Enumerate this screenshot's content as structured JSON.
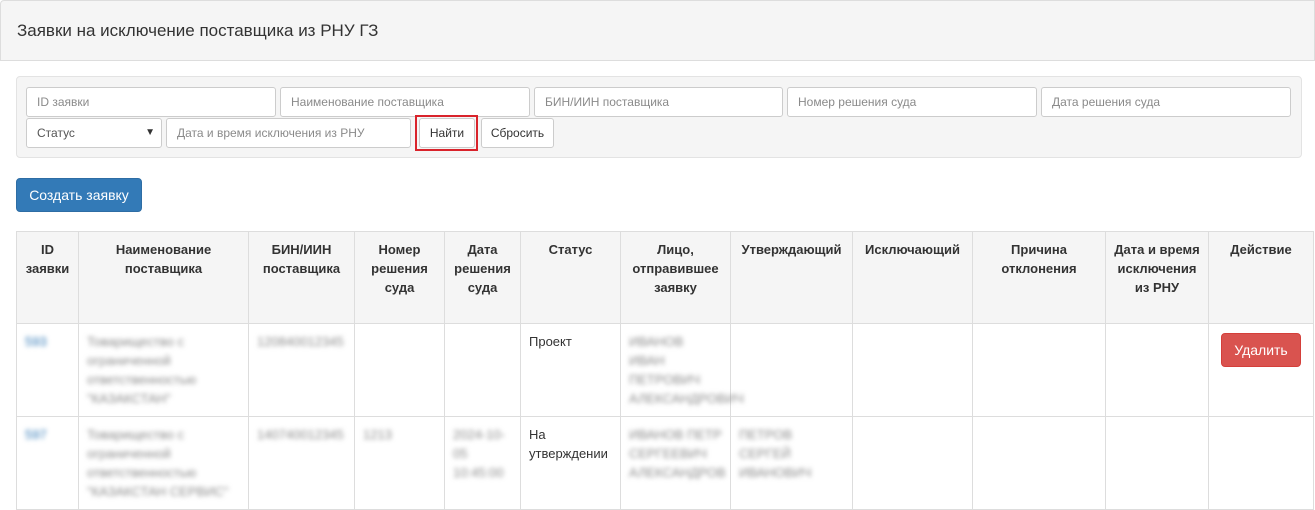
{
  "header": {
    "title": "Заявки на исключение поставщика из РНУ ГЗ"
  },
  "filters": {
    "id_placeholder": "ID заявки",
    "name_placeholder": "Наименование поставщика",
    "bin_placeholder": "БИН/ИИН поставщика",
    "decision_no_placeholder": "Номер решения суда",
    "decision_date_placeholder": "Дата решения суда",
    "status_selected": "Статус",
    "exclusion_dt_placeholder": "Дата и время исключения из РНУ",
    "find_label": "Найти",
    "reset_label": "Сбросить"
  },
  "actions": {
    "create_label": "Создать заявку"
  },
  "table": {
    "columns": [
      "ID заявки",
      "Наименование поставщика",
      "БИН/ИИН поставщика",
      "Номер решения суда",
      "Дата решения суда",
      "Статус",
      "Лицо, отправившее заявку",
      "Утверждающий",
      "Исключающий",
      "Причина отклонения",
      "Дата и время исключения из РНУ",
      "Действие"
    ],
    "rows": [
      {
        "id": "593",
        "supplier": "Товарищество с ограниченной ответственностью \"КАЗАКСТАН\"",
        "bin": "120840012345",
        "decision_no": "",
        "decision_date": "",
        "status": "Проект",
        "sender": "ИВАНОВ ИВАН ПЕТРОВИЧ АЛЕКСАНДРОВИЧ",
        "approver": "",
        "excluder": "",
        "reject_reason": "",
        "exclusion_dt": "",
        "action_label": "Удалить"
      },
      {
        "id": "597",
        "supplier": "Товарищество с ограниченной ответственностью \"КАЗАКСТАН СЕРВИС\"",
        "bin": "140740012345",
        "decision_no": "1213",
        "decision_date": "2024-10-05 10:45:00",
        "status": "На утверждении",
        "sender": "ИВАНОВ ПЕТР СЕРГЕЕВИЧ АЛЕКСАНДРОВ",
        "approver": "ПЕТРОВ СЕРГЕЙ ИВАНОВИЧ",
        "excluder": "",
        "reject_reason": "",
        "exclusion_dt": "",
        "action_label": ""
      }
    ]
  },
  "colors": {
    "primary": "#337ab7",
    "danger": "#d9534f",
    "highlight": "#d9232b"
  }
}
